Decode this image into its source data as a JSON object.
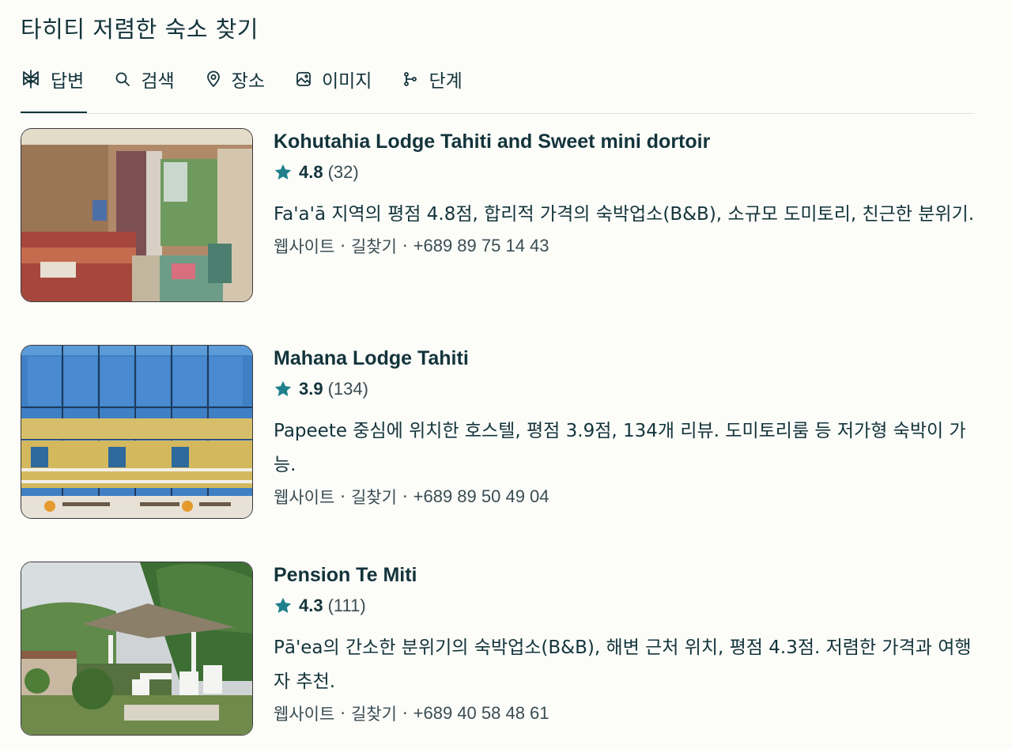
{
  "page": {
    "title": "타히티 저렴한 숙소 찾기"
  },
  "tabs": [
    {
      "label": "답변",
      "icon": "perplexity-logo-icon",
      "active": true
    },
    {
      "label": "검색",
      "icon": "search-icon",
      "active": false
    },
    {
      "label": "장소",
      "icon": "map-pin-icon",
      "active": false
    },
    {
      "label": "이미지",
      "icon": "image-icon",
      "active": false
    },
    {
      "label": "단계",
      "icon": "steps-icon",
      "active": false
    }
  ],
  "results": [
    {
      "name": "Kohutahia Lodge Tahiti and Sweet mini dortoir",
      "rating": "4.8",
      "reviews": "(32)",
      "description": "Fa'a'ā 지역의 평점 4.8점, 합리적 가격의 숙박업소(B&B), 소규모 도미토리, 친근한 분위기.",
      "website_label": "웹사이트",
      "directions_label": "길찾기",
      "separator": "·",
      "phone": "+689 89 75 14 43",
      "image": "bedroom-photo"
    },
    {
      "name": "Mahana Lodge Tahiti",
      "rating": "3.9",
      "reviews": "(134)",
      "description": "Papeete 중심에 위치한 호스텔, 평점 3.9점, 134개 리뷰. 도미토리룸 등 저가형 숙박이 가능.",
      "website_label": "웹사이트",
      "directions_label": "길찾기",
      "separator": "·",
      "phone": "+689 89 50 49 04",
      "image": "building-photo"
    },
    {
      "name": "Pension Te Miti",
      "rating": "4.3",
      "reviews": "(111)",
      "description": "Pā'ea의 간소한 분위기의 숙박업소(B&B), 해변 근처 위치, 평점 4.3점. 저렴한 가격과 여행자 추천.",
      "website_label": "웹사이트",
      "directions_label": "길찾기",
      "separator": "·",
      "phone": "+689 40 58 48 61",
      "image": "garden-photo"
    }
  ],
  "colors": {
    "background": "#fcfcf9",
    "text": "#13343b",
    "star": "#20808d"
  }
}
